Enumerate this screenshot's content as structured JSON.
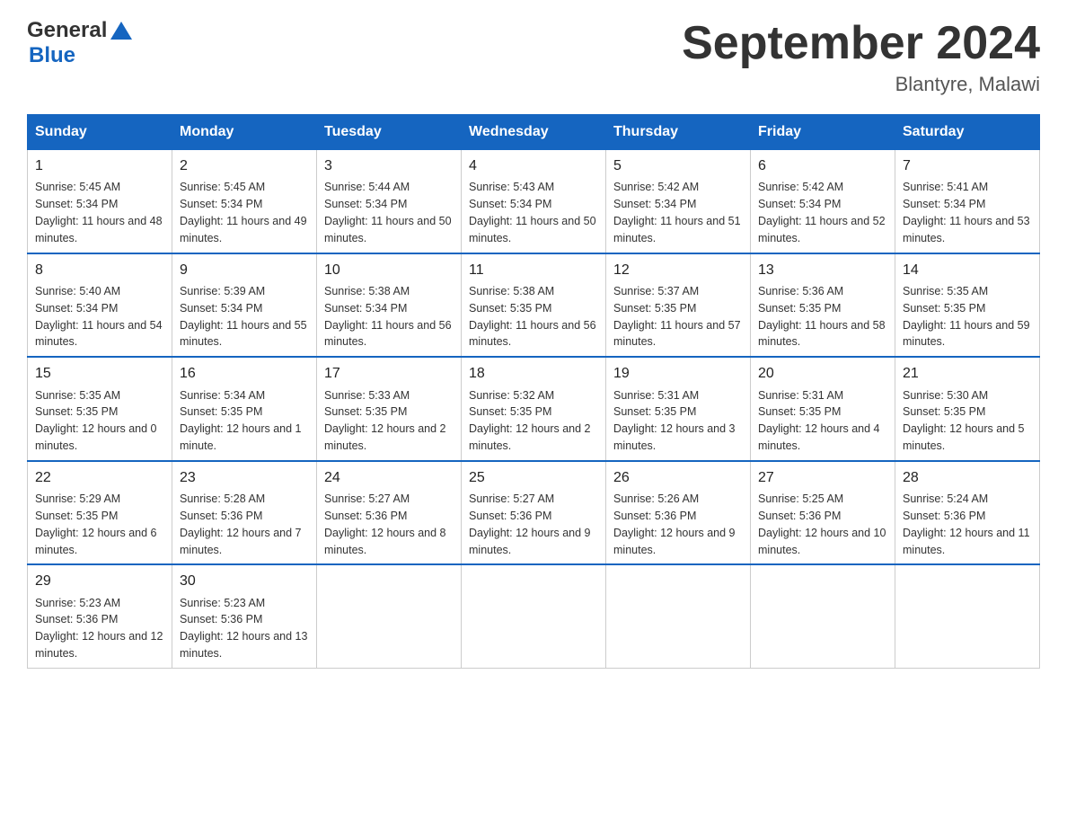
{
  "header": {
    "logo_general": "General",
    "logo_blue": "Blue",
    "title": "September 2024",
    "subtitle": "Blantyre, Malawi"
  },
  "days_of_week": [
    "Sunday",
    "Monday",
    "Tuesday",
    "Wednesday",
    "Thursday",
    "Friday",
    "Saturday"
  ],
  "weeks": [
    [
      {
        "day": "1",
        "sunrise": "5:45 AM",
        "sunset": "5:34 PM",
        "daylight": "11 hours and 48 minutes."
      },
      {
        "day": "2",
        "sunrise": "5:45 AM",
        "sunset": "5:34 PM",
        "daylight": "11 hours and 49 minutes."
      },
      {
        "day": "3",
        "sunrise": "5:44 AM",
        "sunset": "5:34 PM",
        "daylight": "11 hours and 50 minutes."
      },
      {
        "day": "4",
        "sunrise": "5:43 AM",
        "sunset": "5:34 PM",
        "daylight": "11 hours and 50 minutes."
      },
      {
        "day": "5",
        "sunrise": "5:42 AM",
        "sunset": "5:34 PM",
        "daylight": "11 hours and 51 minutes."
      },
      {
        "day": "6",
        "sunrise": "5:42 AM",
        "sunset": "5:34 PM",
        "daylight": "11 hours and 52 minutes."
      },
      {
        "day": "7",
        "sunrise": "5:41 AM",
        "sunset": "5:34 PM",
        "daylight": "11 hours and 53 minutes."
      }
    ],
    [
      {
        "day": "8",
        "sunrise": "5:40 AM",
        "sunset": "5:34 PM",
        "daylight": "11 hours and 54 minutes."
      },
      {
        "day": "9",
        "sunrise": "5:39 AM",
        "sunset": "5:34 PM",
        "daylight": "11 hours and 55 minutes."
      },
      {
        "day": "10",
        "sunrise": "5:38 AM",
        "sunset": "5:34 PM",
        "daylight": "11 hours and 56 minutes."
      },
      {
        "day": "11",
        "sunrise": "5:38 AM",
        "sunset": "5:35 PM",
        "daylight": "11 hours and 56 minutes."
      },
      {
        "day": "12",
        "sunrise": "5:37 AM",
        "sunset": "5:35 PM",
        "daylight": "11 hours and 57 minutes."
      },
      {
        "day": "13",
        "sunrise": "5:36 AM",
        "sunset": "5:35 PM",
        "daylight": "11 hours and 58 minutes."
      },
      {
        "day": "14",
        "sunrise": "5:35 AM",
        "sunset": "5:35 PM",
        "daylight": "11 hours and 59 minutes."
      }
    ],
    [
      {
        "day": "15",
        "sunrise": "5:35 AM",
        "sunset": "5:35 PM",
        "daylight": "12 hours and 0 minutes."
      },
      {
        "day": "16",
        "sunrise": "5:34 AM",
        "sunset": "5:35 PM",
        "daylight": "12 hours and 1 minute."
      },
      {
        "day": "17",
        "sunrise": "5:33 AM",
        "sunset": "5:35 PM",
        "daylight": "12 hours and 2 minutes."
      },
      {
        "day": "18",
        "sunrise": "5:32 AM",
        "sunset": "5:35 PM",
        "daylight": "12 hours and 2 minutes."
      },
      {
        "day": "19",
        "sunrise": "5:31 AM",
        "sunset": "5:35 PM",
        "daylight": "12 hours and 3 minutes."
      },
      {
        "day": "20",
        "sunrise": "5:31 AM",
        "sunset": "5:35 PM",
        "daylight": "12 hours and 4 minutes."
      },
      {
        "day": "21",
        "sunrise": "5:30 AM",
        "sunset": "5:35 PM",
        "daylight": "12 hours and 5 minutes."
      }
    ],
    [
      {
        "day": "22",
        "sunrise": "5:29 AM",
        "sunset": "5:35 PM",
        "daylight": "12 hours and 6 minutes."
      },
      {
        "day": "23",
        "sunrise": "5:28 AM",
        "sunset": "5:36 PM",
        "daylight": "12 hours and 7 minutes."
      },
      {
        "day": "24",
        "sunrise": "5:27 AM",
        "sunset": "5:36 PM",
        "daylight": "12 hours and 8 minutes."
      },
      {
        "day": "25",
        "sunrise": "5:27 AM",
        "sunset": "5:36 PM",
        "daylight": "12 hours and 9 minutes."
      },
      {
        "day": "26",
        "sunrise": "5:26 AM",
        "sunset": "5:36 PM",
        "daylight": "12 hours and 9 minutes."
      },
      {
        "day": "27",
        "sunrise": "5:25 AM",
        "sunset": "5:36 PM",
        "daylight": "12 hours and 10 minutes."
      },
      {
        "day": "28",
        "sunrise": "5:24 AM",
        "sunset": "5:36 PM",
        "daylight": "12 hours and 11 minutes."
      }
    ],
    [
      {
        "day": "29",
        "sunrise": "5:23 AM",
        "sunset": "5:36 PM",
        "daylight": "12 hours and 12 minutes."
      },
      {
        "day": "30",
        "sunrise": "5:23 AM",
        "sunset": "5:36 PM",
        "daylight": "12 hours and 13 minutes."
      },
      null,
      null,
      null,
      null,
      null
    ]
  ],
  "labels": {
    "sunrise": "Sunrise:",
    "sunset": "Sunset:",
    "daylight": "Daylight:"
  }
}
